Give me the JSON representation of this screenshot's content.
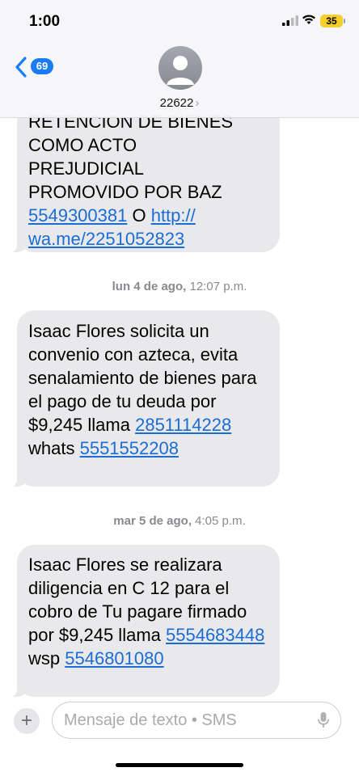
{
  "status_bar": {
    "time": "1:00",
    "battery": "35"
  },
  "header": {
    "back_count": "69",
    "contact": "22622"
  },
  "messages": [
    {
      "lines": [
        "RETENCION DE BIENES",
        "COMO ACTO",
        "PREJUDICIAL",
        "PROMOVIDO POR BAZ"
      ],
      "phone": "5549300381",
      "connector": " O ",
      "url_part1": "http://",
      "url_part2": "wa.me/2251052823"
    },
    {
      "timestamp_day": "lun 4 de ago,",
      "timestamp_time": "12:07 p.m.",
      "text": "Isaac Flores solicita un convenio con azteca, evita senalamiento de bienes para el pago de tu deuda por $9,245 llama ",
      "phone1": "2851114228",
      "mid": " whats ",
      "phone2": "5551552208"
    },
    {
      "timestamp_day": "mar 5 de ago,",
      "timestamp_time": "4:05 p.m.",
      "text": "Isaac Flores se realizara diligencia en C 12 para el cobro de Tu pagare firmado por $9,245 llama ",
      "phone1": "5554683448",
      "mid": " wsp ",
      "phone2": "5546801080"
    }
  ],
  "composer": {
    "placeholder": "Mensaje de texto • SMS"
  },
  "icons": {
    "back": "chevron-left-icon",
    "avatar": "person-icon",
    "plus": "plus-icon",
    "mic": "microphone-icon"
  },
  "colors": {
    "accent": "#1a7cf5",
    "bubble": "#e9e9eb",
    "battery": "#f5cf2c"
  }
}
